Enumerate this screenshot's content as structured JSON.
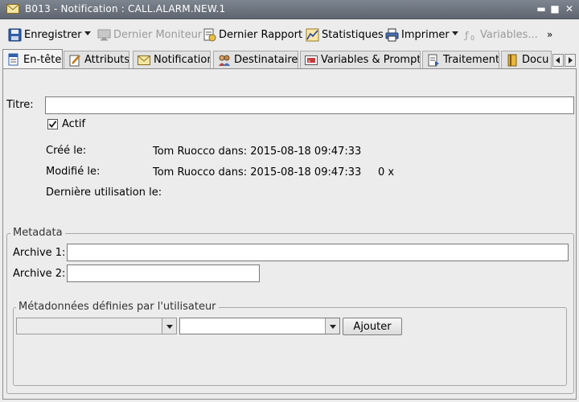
{
  "window": {
    "title": "B013 - Notification : CALL.ALARM.NEW.1"
  },
  "toolbar": {
    "save_label": "Enregistrer",
    "last_monitor_label": "Dernier Moniteur",
    "last_report_label": "Dernier Rapport",
    "statistics_label": "Statistiques",
    "print_label": "Imprimer",
    "variables_label": "Variables...",
    "overflow_label": "»"
  },
  "tabs": [
    {
      "label": "En-tête",
      "active": true
    },
    {
      "label": "Attributs"
    },
    {
      "label": "Notification"
    },
    {
      "label": "Destinataires"
    },
    {
      "label": "Variables & Prompts"
    },
    {
      "label": "Traitement"
    },
    {
      "label": "Docu"
    }
  ],
  "header": {
    "title_label": "Titre:",
    "title_value": "",
    "active_label": "Actif",
    "active_checked": true,
    "created_label": "Créé le:",
    "created_value": "Tom Ruocco dans: 2015-08-18 09:47:33",
    "modified_label": "Modifié le:",
    "modified_value": "Tom Ruocco dans: 2015-08-18 09:47:33",
    "modified_count": "0 x",
    "last_used_label": "Dernière utilisation le:",
    "last_used_value": ""
  },
  "metadata": {
    "group_title": "Metadata",
    "archive1_label": "Archive 1:",
    "archive1_value": "",
    "archive2_label": "Archive 2:",
    "archive2_value": "",
    "user_group_title": "Métadonnées définies par l'utilisateur",
    "key_select_value": "",
    "value_select_value": "",
    "add_button_label": "Ajouter"
  }
}
